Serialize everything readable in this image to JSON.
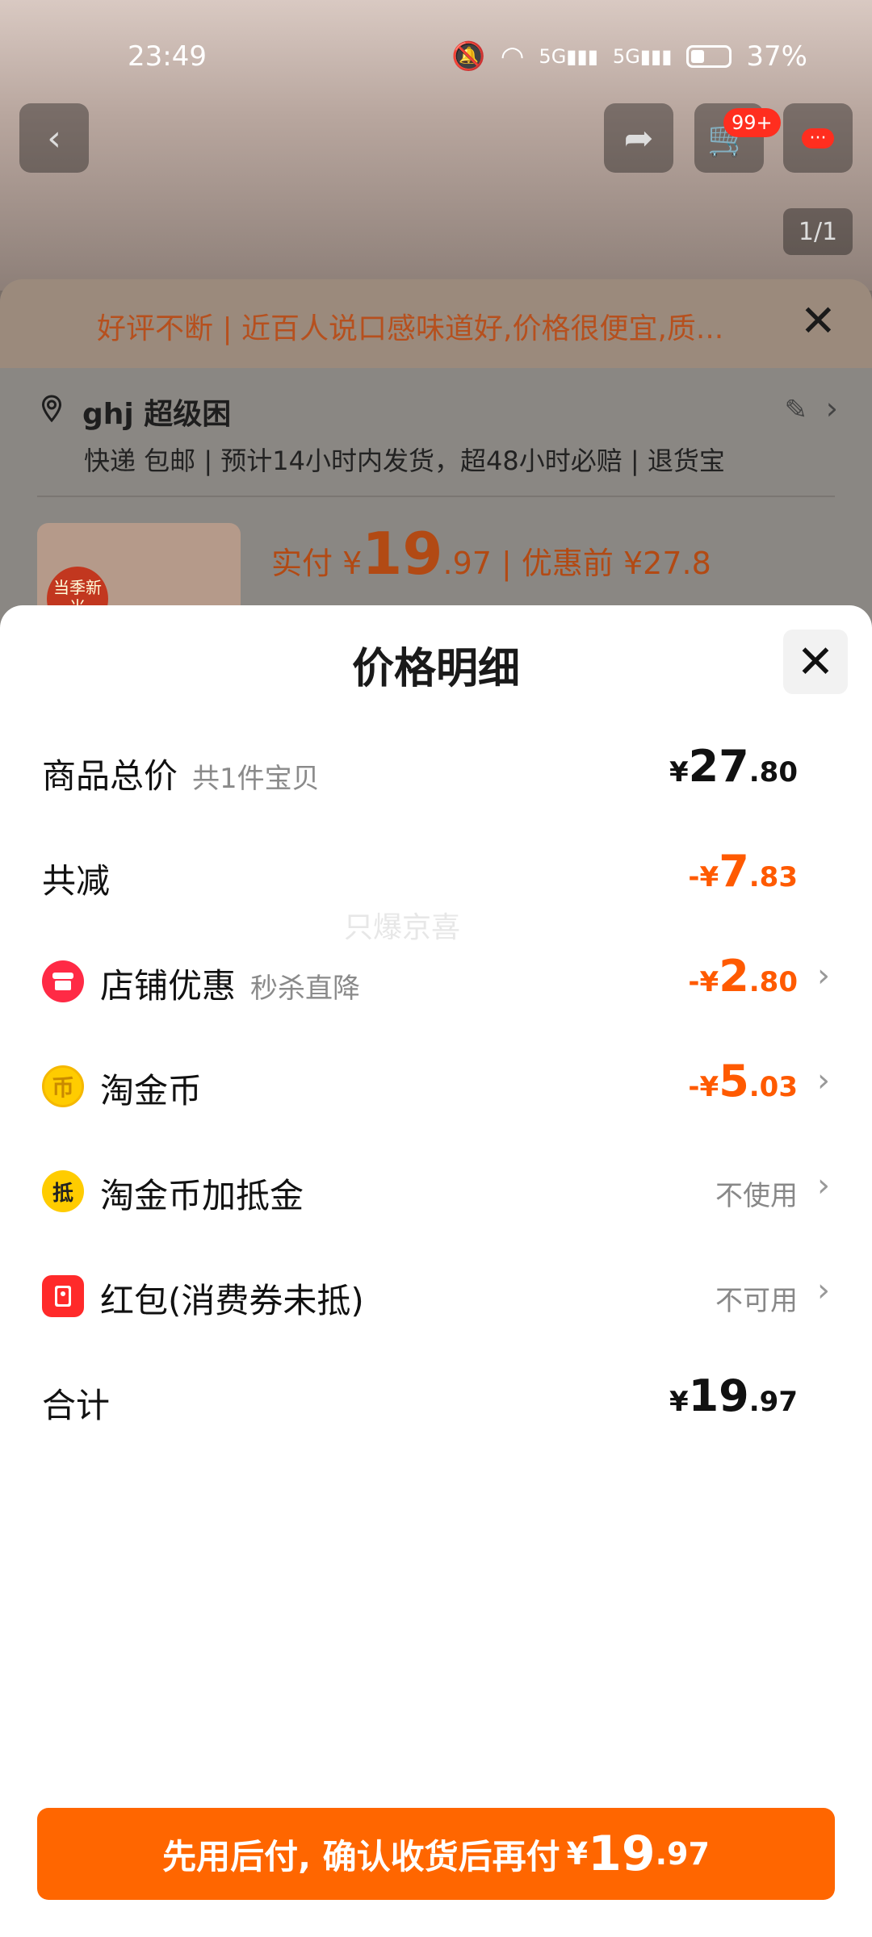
{
  "status_bar": {
    "time": "23:49",
    "battery": "37%"
  },
  "header": {
    "cart_badge": "99+",
    "image_counter": "1/1"
  },
  "notice": {
    "text": "好评不断 | 近百人说口感味道好,价格很便宜,质...",
    "close": "✕"
  },
  "address": {
    "name": "ghj 超级困",
    "shipping": "快递 包邮 | 预计14小时内发货，超48小时必赔 | 退货宝"
  },
  "product": {
    "tag": "当季新米",
    "paid_label": "实付",
    "currency": "¥",
    "paid_int": "19",
    "paid_dec": ".97",
    "before_label": "| 优惠前 ¥27.8"
  },
  "modal": {
    "title": "价格明细",
    "close": "✕",
    "rows": {
      "total": {
        "label": "商品总价",
        "sub": "共1件宝贝",
        "currency": "¥",
        "int": "27",
        "dec": ".80"
      },
      "reduce": {
        "label": "共减",
        "currency": "-¥",
        "int": "7",
        "dec": ".83"
      },
      "store": {
        "label": "店铺优惠",
        "sub": "秒杀直降",
        "currency": "-¥",
        "int": "2",
        "dec": ".80",
        "icon": "store-icon",
        "icon_color": "#ff2a45"
      },
      "coins": {
        "label": "淘金币",
        "currency": "-¥",
        "int": "5",
        "dec": ".03",
        "icon": "coin-icon",
        "icon_color": "#ffcc00"
      },
      "coin_voucher": {
        "label": "淘金币加抵金",
        "status": "不使用",
        "icon": "voucher-icon",
        "icon_glyph": "抵",
        "icon_color": "#ffcc00"
      },
      "red_packet": {
        "label": "红包(消费券未抵)",
        "status": "不可用",
        "icon": "red-packet-icon",
        "icon_color": "#ff2a2a"
      },
      "sum": {
        "label": "合计",
        "currency": "¥",
        "int": "19",
        "dec": ".97"
      }
    },
    "watermark": "只爆京喜"
  },
  "pay_button": {
    "label": "先用后付, 确认收货后再付",
    "currency": "¥",
    "int": "19",
    "dec": ".97"
  },
  "colors": {
    "accent": "#ff6600",
    "discount": "#ff5a00"
  }
}
